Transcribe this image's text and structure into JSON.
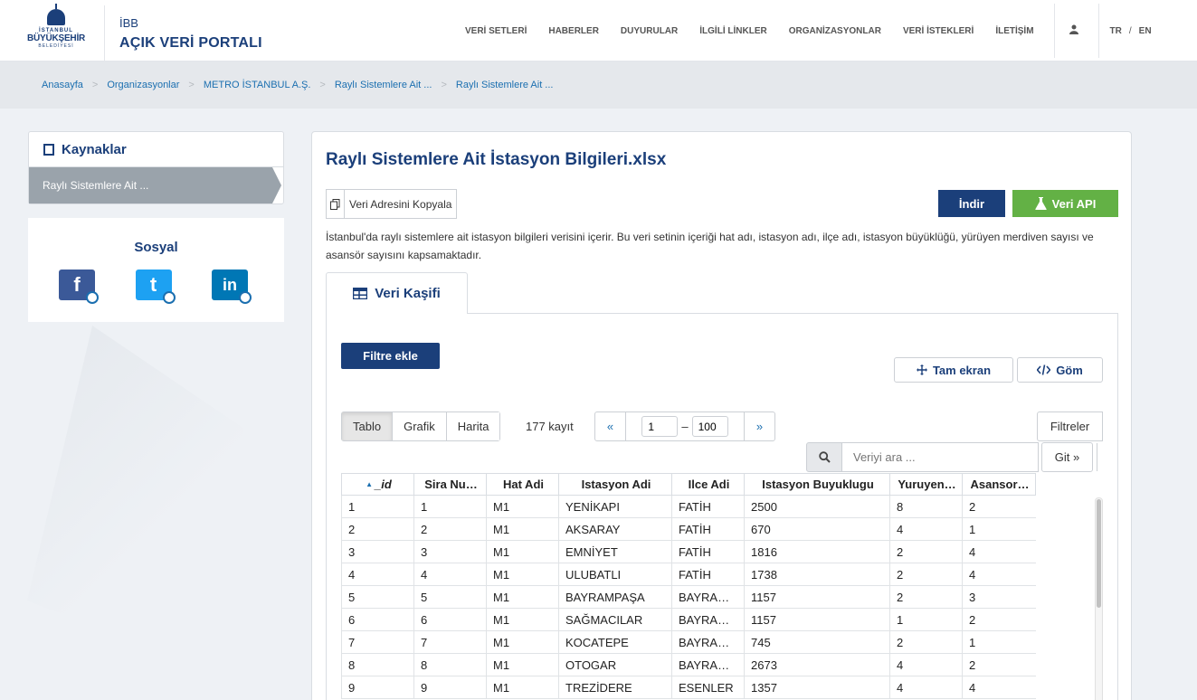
{
  "logo": {
    "line1": "İSTANBUL",
    "line2": "BÜYÜKŞEHİR",
    "line3": "BELEDİYESİ"
  },
  "brand": {
    "ibb": "İBB",
    "portal": "AÇIK VERİ PORTALI"
  },
  "nav": {
    "items": [
      "VERİ SETLERİ",
      "HABERLER",
      "DUYURULAR",
      "İLGİLİ LİNKLER",
      "ORGANİZASYONLAR",
      "VERİ İSTEKLERİ",
      "İLETİŞİM"
    ],
    "user_icon": "user-icon",
    "lang_tr": "TR",
    "lang_sep": "/",
    "lang_en": "EN"
  },
  "breadcrumb": [
    "Anasayfa",
    "Organizasyonlar",
    "METRO İSTANBUL A.Ş.",
    "Raylı Sistemlere Ait ...",
    "Raylı Sistemlere Ait ..."
  ],
  "sidebar": {
    "title": "Kaynaklar",
    "items": [
      "Raylı Sistemlere Ait ..."
    ]
  },
  "social": {
    "title": "Sosyal",
    "icons": [
      {
        "name": "facebook-share-icon",
        "glyph": "f",
        "color": "#3b5998"
      },
      {
        "name": "twitter-share-icon",
        "glyph": "t",
        "color": "#1da1f2"
      },
      {
        "name": "linkedin-share-icon",
        "glyph": "in",
        "color": "#0077b5"
      }
    ]
  },
  "main": {
    "title": "Raylı Sistemlere Ait İstasyon Bilgileri.xlsx",
    "copy_label": "Veri Adresini Kopyala",
    "download_label": "İndir",
    "api_label": "Veri API",
    "description": "İstanbul'da raylı sistemlere ait istasyon bilgileri verisini içerir. Bu veri setinin içeriği hat adı, istasyon adı, ilçe adı, istasyon büyüklüğü, yürüyen merdiven sayısı ve asansör sayısını kapsamaktadır.",
    "tab_label": "Veri Kaşifi"
  },
  "explorer": {
    "add_filter": "Filtre ekle",
    "fullscreen": "Tam ekran",
    "embed": "Göm",
    "views": [
      "Tablo",
      "Grafik",
      "Harita"
    ],
    "active_view": "Tablo",
    "record_count": "177 kayıt",
    "prev": "«",
    "next": "»",
    "page_from": "1",
    "page_dash": "–",
    "page_to": "100",
    "filters": "Filtreler",
    "search_placeholder": "Veriyi ara ...",
    "go": "Git »"
  },
  "grid": {
    "columns": [
      "_id",
      "Sira Nu…",
      "Hat Adi",
      "Istasyon Adi",
      "Ilce Adi",
      "Istasyon Buyuklugu",
      "Yuruyen…",
      "Asansor…"
    ],
    "rows": [
      [
        "1",
        "1",
        "M1",
        "YENİKAPI",
        "FATİH",
        "2500",
        "8",
        "2"
      ],
      [
        "2",
        "2",
        "M1",
        "AKSARAY",
        "FATİH",
        "670",
        "4",
        "1"
      ],
      [
        "3",
        "3",
        "M1",
        "EMNİYET",
        "FATİH",
        "1816",
        "2",
        "4"
      ],
      [
        "4",
        "4",
        "M1",
        "ULUBATLI",
        "FATİH",
        "1738",
        "2",
        "4"
      ],
      [
        "5",
        "5",
        "M1",
        "BAYRAMPAŞA",
        "BAYRA…",
        "1157",
        "2",
        "3"
      ],
      [
        "6",
        "6",
        "M1",
        "SAĞMACILAR",
        "BAYRA…",
        "1157",
        "1",
        "2"
      ],
      [
        "7",
        "7",
        "M1",
        "KOCATEPE",
        "BAYRA…",
        "745",
        "2",
        "1"
      ],
      [
        "8",
        "8",
        "M1",
        "OTOGAR",
        "BAYRA…",
        "2673",
        "4",
        "2"
      ],
      [
        "9",
        "9",
        "M1",
        "TREZİDERE",
        "ESENLER",
        "1357",
        "4",
        "4"
      ]
    ]
  },
  "colors": {
    "brand": "#1b3f7a",
    "api": "#63b145",
    "link": "#1b6fb0"
  }
}
